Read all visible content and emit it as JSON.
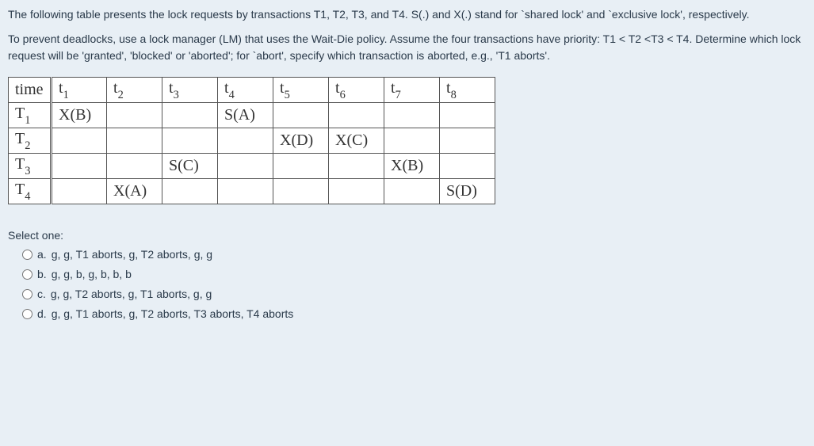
{
  "intro": {
    "para1": "The following table presents the lock requests by transactions T1, T2, T3, and T4. S(.) and X(.) stand for `shared lock' and `exclusive lock', respectively.",
    "para2": "To prevent deadlocks, use a lock manager (LM) that uses the Wait-Die policy. Assume the four transactions have priority: T1 < T2 <T3 < T4. Determine which lock request will be 'granted', 'blocked' or 'aborted'; for `abort', specify which transaction is aborted, e.g., 'T1 aborts'."
  },
  "table": {
    "time_label": "time",
    "time_cols": [
      "t",
      "t",
      "t",
      "t",
      "t",
      "t",
      "t",
      "t"
    ],
    "time_subs": [
      "1",
      "2",
      "3",
      "4",
      "5",
      "6",
      "7",
      "8"
    ],
    "row_labels": [
      "T",
      "T",
      "T",
      "T"
    ],
    "row_subs": [
      "1",
      "2",
      "3",
      "4"
    ],
    "cells": [
      [
        "X(B)",
        "",
        "",
        "S(A)",
        "",
        "",
        "",
        ""
      ],
      [
        "",
        "",
        "",
        "",
        "X(D)",
        "X(C)",
        "",
        ""
      ],
      [
        "",
        "",
        "S(C)",
        "",
        "",
        "",
        "X(B)",
        ""
      ],
      [
        "",
        "X(A)",
        "",
        "",
        "",
        "",
        "",
        "S(D)"
      ]
    ]
  },
  "select_one": "Select one:",
  "options": {
    "a": {
      "letter": "a.",
      "text": "g, g, T1 aborts, g, T2 aborts, g, g"
    },
    "b": {
      "letter": "b.",
      "text": "g, g, b, g, b, b, b"
    },
    "c": {
      "letter": "c.",
      "text": "g, g, T2 aborts, g, T1 aborts, g, g"
    },
    "d": {
      "letter": "d.",
      "text": "g, g, T1 aborts, g, T2 aborts, T3 aborts, T4 aborts"
    }
  }
}
